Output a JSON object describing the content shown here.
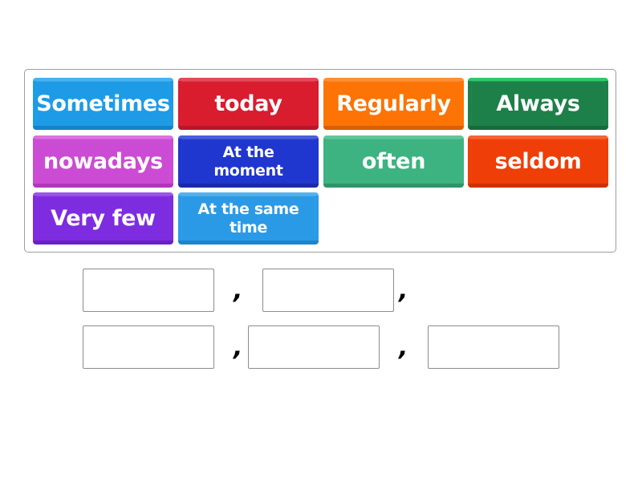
{
  "word_bank": {
    "tiles": [
      {
        "label": "Sometimes",
        "color": "#1e9be6",
        "top_color": "#45b3f0",
        "bottom_color": "#1583c9"
      },
      {
        "label": "today",
        "color": "#d91c2e",
        "top_color": "#e34a5a",
        "bottom_color": "#b8172a"
      },
      {
        "label": "Regularly",
        "color": "#fb7405",
        "top_color": "#fd9035",
        "bottom_color": "#d86004"
      },
      {
        "label": "Always",
        "color": "#1d8048",
        "top_color": "#2fc86a",
        "bottom_color": "#186a3c"
      },
      {
        "label": "nowadays",
        "color": "#cc4bd4",
        "top_color": "#da72e0",
        "bottom_color": "#b038b8"
      },
      {
        "label": "At the moment",
        "color": "#1f36cf",
        "top_color": "#4a5ee0",
        "bottom_color": "#1a2aa8"
      },
      {
        "label": "often",
        "color": "#3db381",
        "top_color": "#62c69b",
        "bottom_color": "#2f9467"
      },
      {
        "label": "seldom",
        "color": "#ef3e07",
        "top_color": "#f56434",
        "bottom_color": "#cc3205"
      },
      {
        "label": "Very few",
        "color": "#7e2ce0",
        "top_color": "#9a56ea",
        "bottom_color": "#6a20c4"
      },
      {
        "label": "At the same time",
        "color": "#2b9ae6",
        "top_color": "#54b2ef",
        "bottom_color": "#1e84cb"
      }
    ]
  },
  "answer_area": {
    "separators": [
      ",",
      ",",
      ",",
      ","
    ],
    "slots": [
      "",
      "",
      "",
      "",
      ""
    ]
  }
}
